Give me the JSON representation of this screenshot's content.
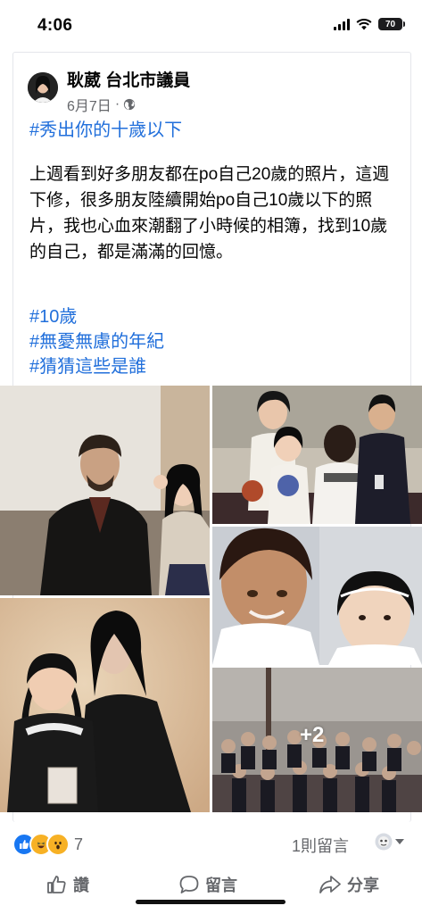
{
  "status_bar": {
    "time": "4:06",
    "battery": "70"
  },
  "post": {
    "author": "耿葳 台北市議員",
    "date": "6月7日",
    "separator": "·",
    "hashtag_top": "#秀出你的十歲以下",
    "body": "上週看到好多朋友都在po自己20歲的照片，這週下修，很多朋友陸續開始po自己10歲以下的照片，我也心血來潮翻了小時候的相簿，找到10歲的自己，都是滿滿的回憶。",
    "tags": [
      "#10歲",
      "#無憂無慮的年紀",
      "#猜猜這些是誰"
    ],
    "more_photos": "+2"
  },
  "reactions": {
    "icons": [
      "like-icon",
      "haha-icon",
      "wow-icon"
    ],
    "count": "7",
    "comments": "1則留言"
  },
  "actions": {
    "like": "讚",
    "comment": "留言",
    "share": "分享"
  },
  "colors": {
    "link": "#216fdb",
    "like_blue": "#1877f2",
    "secondary": "#65676b"
  }
}
